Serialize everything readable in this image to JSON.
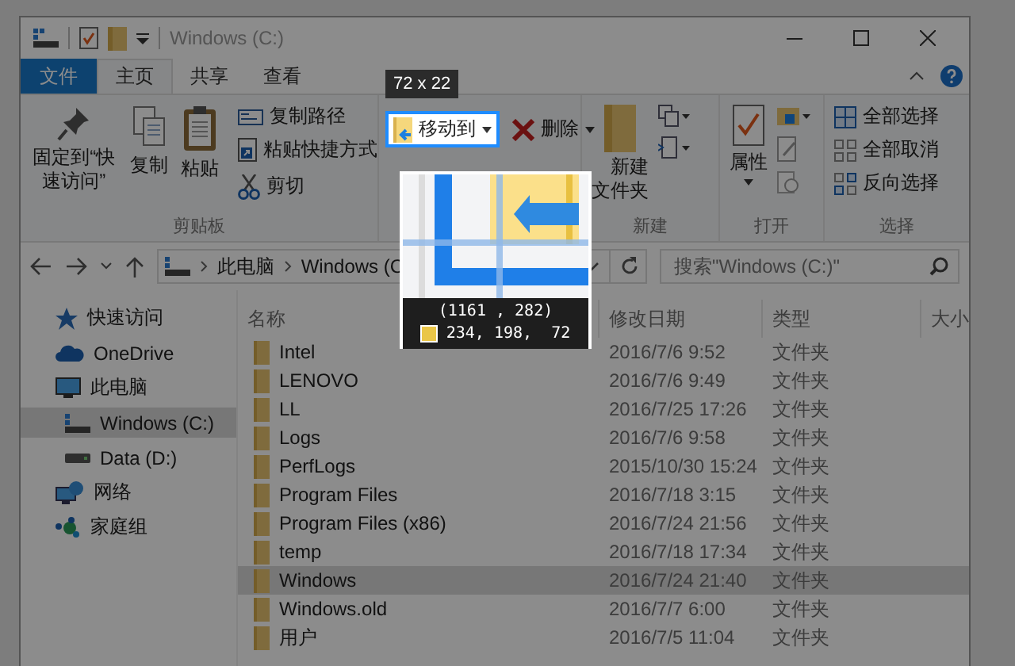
{
  "window": {
    "title": "Windows (C:)"
  },
  "ribbon_tabs": [
    {
      "label": "文件",
      "selected": false,
      "kind": "file"
    },
    {
      "label": "主页",
      "selected": true,
      "kind": "tab"
    },
    {
      "label": "共享",
      "selected": false,
      "kind": "tab"
    },
    {
      "label": "查看",
      "selected": false,
      "kind": "tab"
    }
  ],
  "ribbon": {
    "clipboard": {
      "pin": "固定到“快速访问”",
      "copy": "复制",
      "paste": "粘贴",
      "copy_path": "复制路径",
      "paste_shortcut": "粘贴快捷方式",
      "cut": "剪切",
      "label": "剪贴板"
    },
    "organize": {
      "move_to": "移动到",
      "delete": "删除"
    },
    "new": {
      "new_folder": "新建文件夹",
      "label": "新建"
    },
    "open": {
      "properties": "属性",
      "label": "打开"
    },
    "select": {
      "select_all": "全部选择",
      "select_none": "全部取消",
      "invert": "反向选择",
      "label": "选择"
    }
  },
  "address_bar": {
    "breadcrumb": [
      "此电脑",
      "Windows (C"
    ]
  },
  "search": {
    "placeholder": "搜索\"Windows (C:)\""
  },
  "nav": [
    {
      "label": "快速访问",
      "selected": false,
      "kind": "quick"
    },
    {
      "label": "OneDrive",
      "selected": false,
      "kind": "cloud"
    },
    {
      "label": "此电脑",
      "selected": false,
      "kind": "computer",
      "children": [
        {
          "label": "Windows (C:)",
          "selected": true,
          "kind": "sysdrive"
        },
        {
          "label": "Data (D:)",
          "selected": false,
          "kind": "drive"
        }
      ]
    },
    {
      "label": "网络",
      "selected": false,
      "kind": "network"
    },
    {
      "label": "家庭组",
      "selected": false,
      "kind": "homegroup"
    }
  ],
  "columns": [
    "名称",
    "修改日期",
    "类型",
    "大小"
  ],
  "rows": [
    {
      "name": "Intel",
      "modified": "2016/7/6 9:52",
      "type": "文件夹",
      "selected": false
    },
    {
      "name": "LENOVO",
      "modified": "2016/7/6 9:49",
      "type": "文件夹",
      "selected": false
    },
    {
      "name": "LL",
      "modified": "2016/7/25 17:26",
      "type": "文件夹",
      "selected": false
    },
    {
      "name": "Logs",
      "modified": "2016/7/6 9:58",
      "type": "文件夹",
      "selected": false
    },
    {
      "name": "PerfLogs",
      "modified": "2015/10/30 15:24",
      "type": "文件夹",
      "selected": false
    },
    {
      "name": "Program Files",
      "modified": "2016/7/18 3:15",
      "type": "文件夹",
      "selected": false
    },
    {
      "name": "Program Files (x86)",
      "modified": "2016/7/24 21:56",
      "type": "文件夹",
      "selected": false
    },
    {
      "name": "temp",
      "modified": "2016/7/18 17:34",
      "type": "文件夹",
      "selected": false
    },
    {
      "name": "Windows",
      "modified": "2016/7/24 21:40",
      "type": "文件夹",
      "selected": true
    },
    {
      "name": "Windows.old",
      "modified": "2016/7/7 6:00",
      "type": "文件夹",
      "selected": false
    },
    {
      "name": "用户",
      "modified": "2016/7/5 11:04",
      "type": "文件夹",
      "selected": false
    }
  ],
  "screen_picker": {
    "size_label": "72 x 22",
    "coordinates": "(1161 , 282)",
    "color": "#eac648",
    "rgb": "234, 198,  72"
  }
}
